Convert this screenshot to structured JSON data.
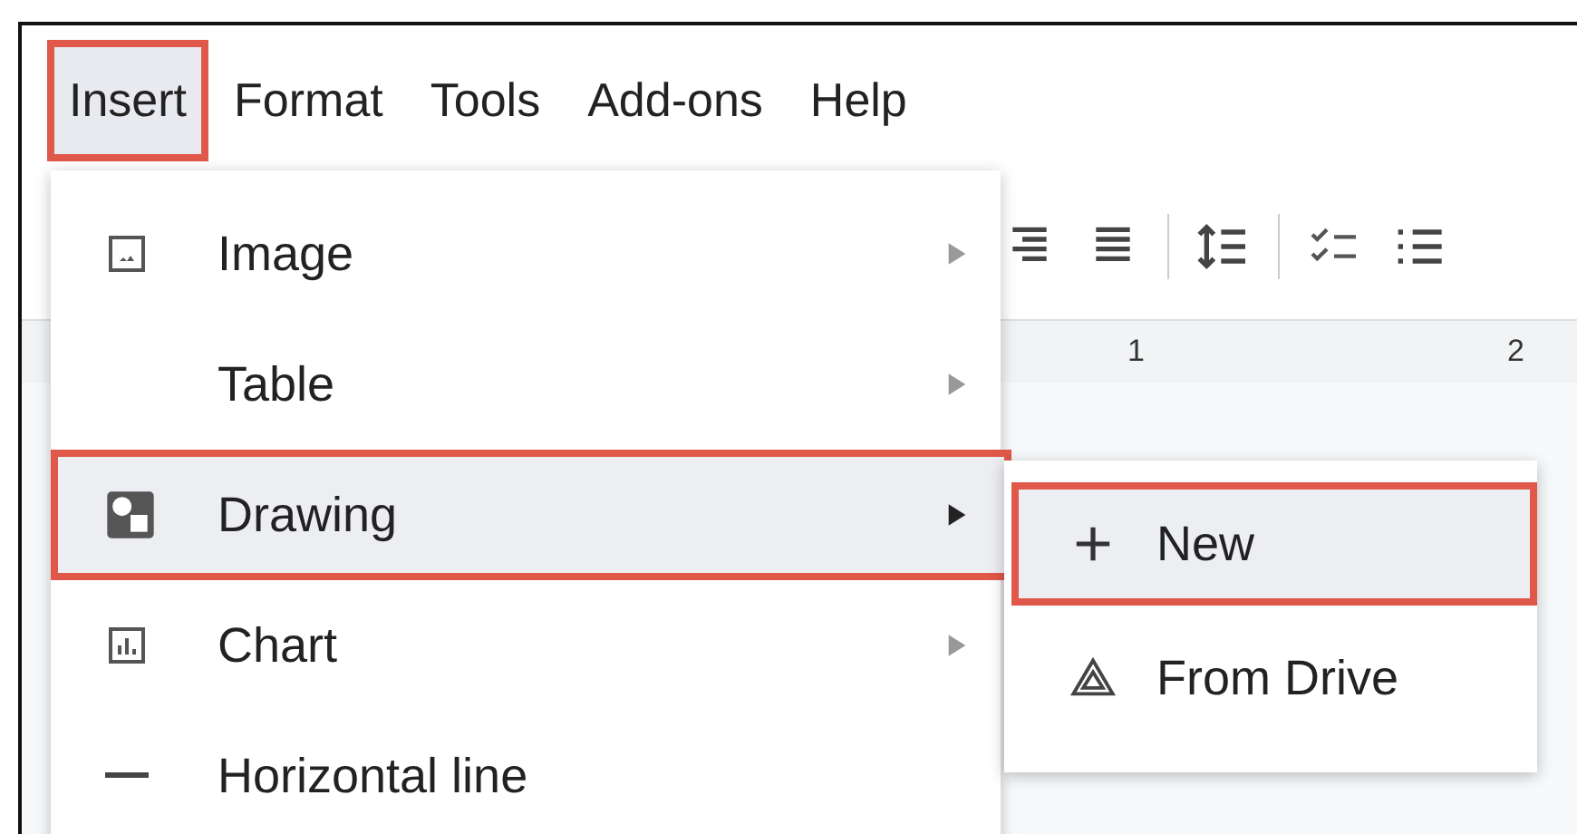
{
  "menubar": [
    {
      "label": "Insert",
      "selected": true,
      "highlighted": true
    },
    {
      "label": "Format",
      "selected": false,
      "highlighted": false
    },
    {
      "label": "Tools",
      "selected": false,
      "highlighted": false
    },
    {
      "label": "Add-ons",
      "selected": false,
      "highlighted": false
    },
    {
      "label": "Help",
      "selected": false,
      "highlighted": false
    }
  ],
  "ruler": {
    "labels": [
      "1",
      "2"
    ]
  },
  "menu": {
    "items": [
      {
        "label": "Image",
        "kind": "image",
        "submenu": true,
        "highlighted": false,
        "selected": false
      },
      {
        "label": "Table",
        "kind": "plain",
        "submenu": true,
        "highlighted": false,
        "selected": false
      },
      {
        "label": "Drawing",
        "kind": "drawing",
        "submenu": true,
        "highlighted": true,
        "selected": true
      },
      {
        "label": "Chart",
        "kind": "chart",
        "submenu": true,
        "highlighted": false,
        "selected": false
      },
      {
        "label": "Horizontal line",
        "kind": "line",
        "submenu": false,
        "highlighted": false,
        "selected": false
      }
    ]
  },
  "submenu": {
    "items": [
      {
        "label": "New",
        "kind": "new",
        "highlighted": true
      },
      {
        "label": "From Drive",
        "kind": "drive",
        "highlighted": false
      }
    ]
  }
}
